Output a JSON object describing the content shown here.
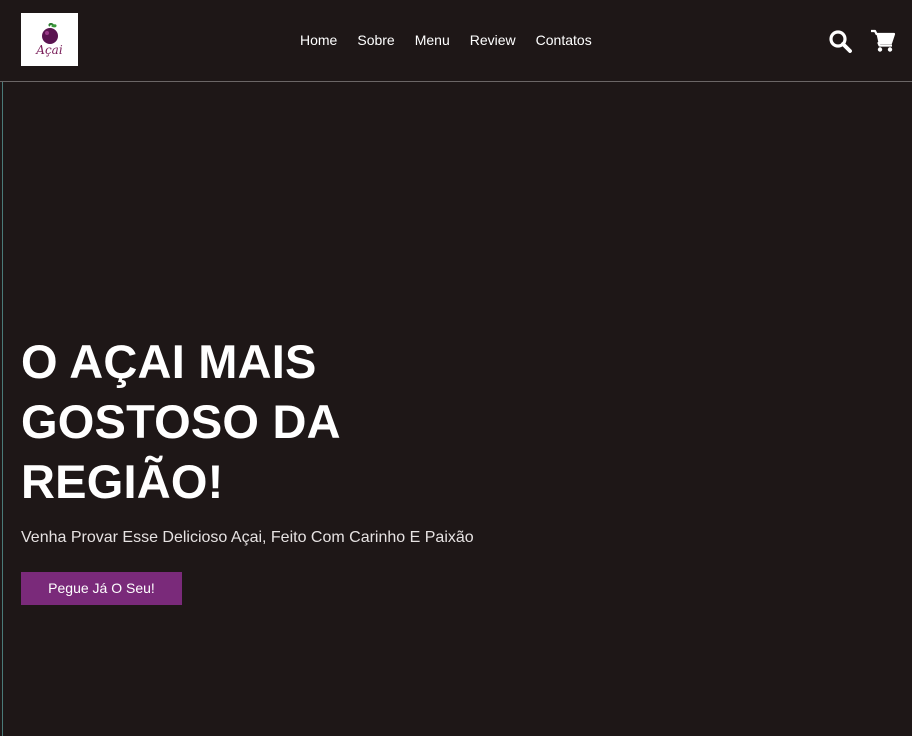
{
  "logo": {
    "text": "Açai"
  },
  "nav": {
    "items": [
      {
        "label": "Home"
      },
      {
        "label": "Sobre"
      },
      {
        "label": "Menu"
      },
      {
        "label": "Review"
      },
      {
        "label": "Contatos"
      }
    ]
  },
  "header_icons": {
    "search": "search-icon",
    "cart": "cart-icon"
  },
  "hero": {
    "title": "O AÇAI MAIS GOSTOSO DA REGIÃO!",
    "subtitle": "Venha Provar Esse Delicioso Açai, Feito Com Carinho E Paixão",
    "cta_label": "Pegue Já O Seu!"
  },
  "colors": {
    "background": "#1e1717",
    "accent": "#7a2a7a",
    "text": "#ffffff"
  }
}
